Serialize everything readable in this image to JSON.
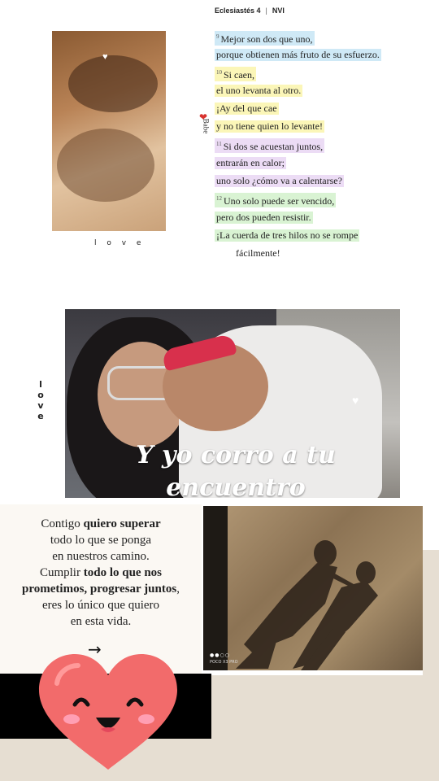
{
  "photo1": {
    "label": "l o v e"
  },
  "bible": {
    "book": "Eclesiastés 4",
    "version": "NVI",
    "side_label": "Babe",
    "verses": [
      {
        "num": "9",
        "text": "Mejor son dos que uno,",
        "color": "blue"
      },
      {
        "num": "",
        "text": "porque obtienen más fruto de su esfuerzo.",
        "color": "blue"
      },
      {
        "num": "10",
        "text": "Si caen,",
        "color": "yellow"
      },
      {
        "num": "",
        "text": "el uno levanta al otro.",
        "color": "yellow"
      },
      {
        "num": "",
        "text": "¡Ay del que cae",
        "color": "yellow"
      },
      {
        "num": "",
        "text": "y no tiene quien lo levante!",
        "color": "yellow"
      },
      {
        "num": "11",
        "text": "Si dos se acuestan juntos,",
        "color": "purple"
      },
      {
        "num": "",
        "text": "entrarán en calor;",
        "color": "purple"
      },
      {
        "num": "",
        "text": "uno solo ¿cómo va a calentarse?",
        "color": "purple"
      },
      {
        "num": "12",
        "text": "Uno solo puede ser vencido,",
        "color": "green"
      },
      {
        "num": "",
        "text": "pero dos pueden resistir.",
        "color": "green"
      },
      {
        "num": "",
        "text": "¡La cuerda de tres hilos no se rompe",
        "color": "green"
      },
      {
        "num": "",
        "text": "fácilmente!",
        "color": "none"
      }
    ]
  },
  "photo2": {
    "side_label": [
      "l",
      "o",
      "v",
      "e"
    ],
    "caption": "Y yo corro a tu encuentro"
  },
  "quote": {
    "lines": [
      [
        {
          "t": "Contigo ",
          "b": false
        },
        {
          "t": "quiero superar",
          "b": true
        }
      ],
      [
        {
          "t": "todo lo que se ponga",
          "b": false
        }
      ],
      [
        {
          "t": "en nuestros camino.",
          "b": false
        }
      ],
      [
        {
          "t": "Cumplir ",
          "b": false
        },
        {
          "t": "todo lo que nos",
          "b": true
        }
      ],
      [
        {
          "t": "prometimos, progresar juntos",
          "b": true
        },
        {
          "t": ",",
          "b": false
        }
      ],
      [
        {
          "t": "eres lo único que quiero",
          "b": false
        }
      ],
      [
        {
          "t": "en esta vida.",
          "b": false
        }
      ]
    ],
    "arrow": "→"
  },
  "photo3": {
    "watermark": "POCO X3 PRO"
  },
  "colors": {
    "hl_blue": "#cfe9f6",
    "hl_yellow": "#fbf6b8",
    "hl_purple": "#ecdcf5",
    "hl_green": "#d9f3d3",
    "heart": "#f26b6b",
    "beige": "#e6ded2"
  },
  "icons": {
    "heart_emoji": "smiling-heart-icon",
    "mini_heart": "white-heart-icon",
    "babe_heart": "red-heart-icon"
  }
}
